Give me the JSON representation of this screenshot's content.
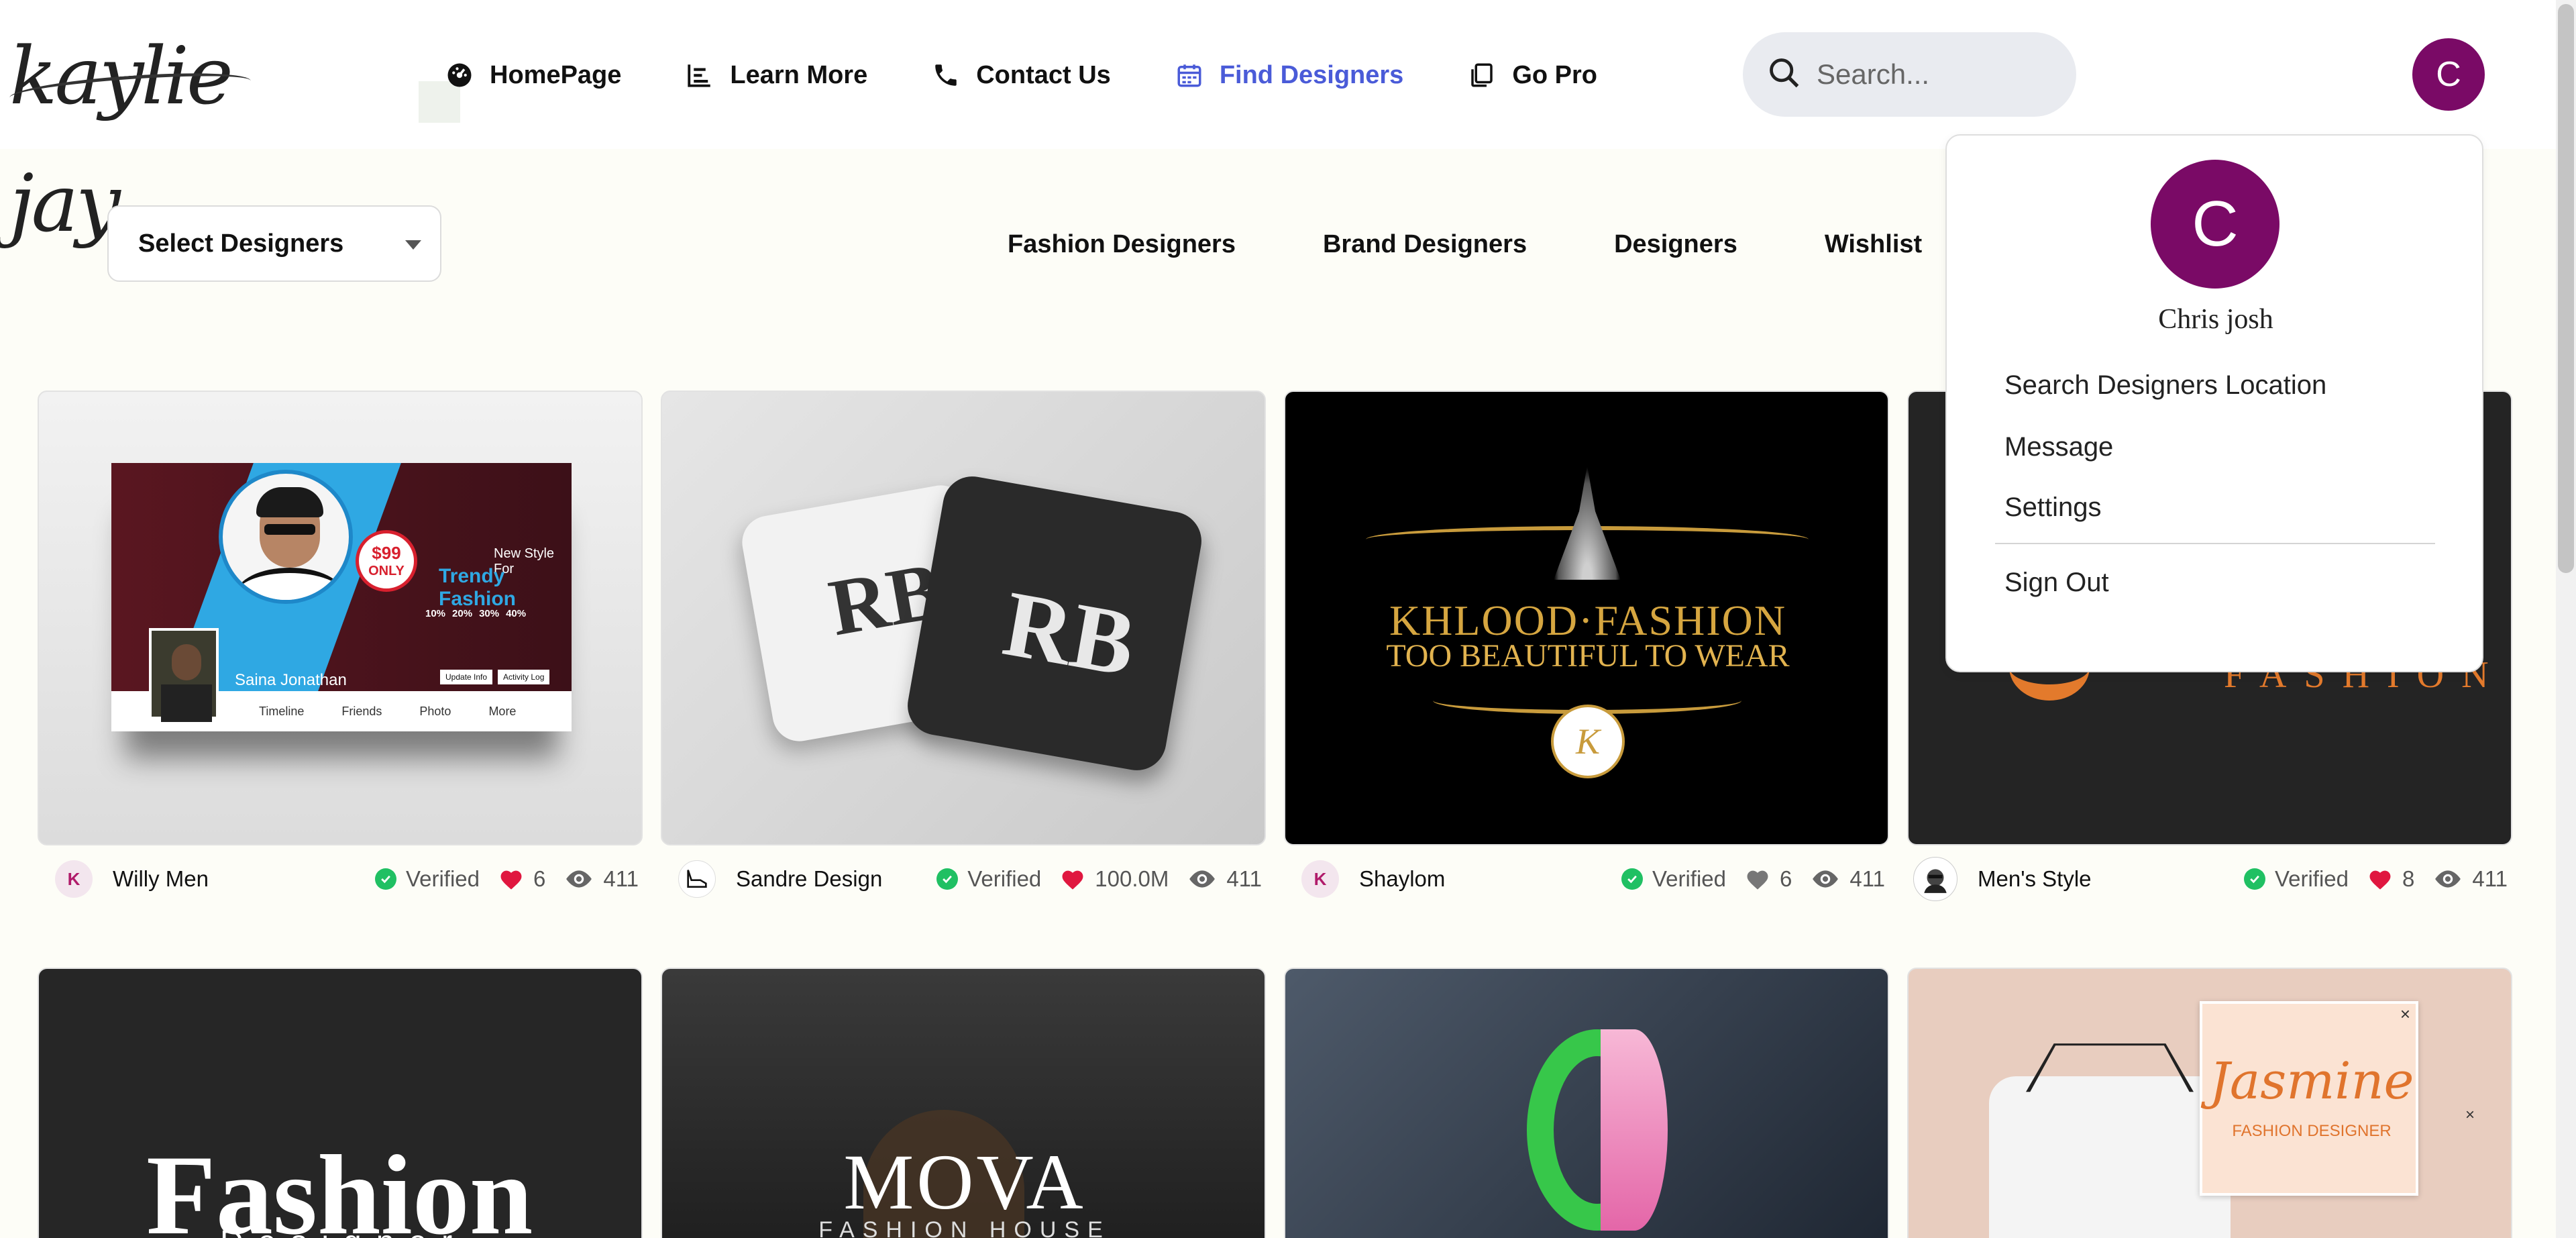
{
  "brand": {
    "logo_text": "kaylie jay"
  },
  "nav": {
    "items": [
      {
        "label": "HomePage",
        "icon": "dashboard-icon"
      },
      {
        "label": "Learn More",
        "icon": "chart-bars-icon"
      },
      {
        "label": "Contact Us",
        "icon": "phone-icon"
      },
      {
        "label": "Find Designers",
        "icon": "calendar-icon",
        "active": true
      },
      {
        "label": "Go Pro",
        "icon": "copy-icon"
      }
    ],
    "active_color": "#4a5bd8"
  },
  "search": {
    "placeholder": "Search..."
  },
  "user": {
    "initial": "C",
    "name": "Chris josh",
    "avatar_color": "#7a0a66"
  },
  "filters": {
    "select_label": "Select Designers",
    "tabs": [
      "Fashion Designers",
      "Brand Designers",
      "Designers",
      "Wishlist"
    ]
  },
  "dropdown_menu": {
    "items": [
      "Search Designers Location",
      "Message",
      "Settings"
    ],
    "sign_out": "Sign Out"
  },
  "cards": [
    {
      "name": "Willy Men",
      "verified": "Verified",
      "likes": "6",
      "views": "411",
      "liked": true,
      "banner": {
        "new_style": "New Style For",
        "trendy": "Trendy Fashion",
        "price": "$99",
        "only": "ONLY",
        "person": "Saina Jonathan",
        "links": [
          "Timeline",
          "Friends",
          "Photo",
          "More"
        ],
        "buttons": [
          "Update Info",
          "Activity Log"
        ],
        "percents": [
          "10%",
          "20%",
          "30%",
          "40%"
        ]
      }
    },
    {
      "name": "Sandre Design",
      "verified": "Verified",
      "likes": "100.0M",
      "views": "411",
      "liked": true,
      "monogram": "RB"
    },
    {
      "name": "Shaylom",
      "verified": "Verified",
      "likes": "6",
      "views": "411",
      "liked": false,
      "title1": "KHLOOD·FASHION",
      "title2": "TOO BEAUTIFUL TO WEAR"
    },
    {
      "name": "Men's Style",
      "verified": "Verified",
      "likes": "8",
      "views": "411",
      "liked": true,
      "word": "FASHION"
    }
  ],
  "row2": [
    {
      "word": "Fashion",
      "sub": "Designer"
    },
    {
      "word": "MOVA",
      "sub": "FASHION HOUSE"
    },
    {
      "word": ""
    },
    {
      "word": "Jasmine",
      "sub": "FASHION DESIGNER"
    }
  ],
  "colors": {
    "verified": "#20c063",
    "heart": "#e0173f",
    "heart_muted": "#777777"
  }
}
